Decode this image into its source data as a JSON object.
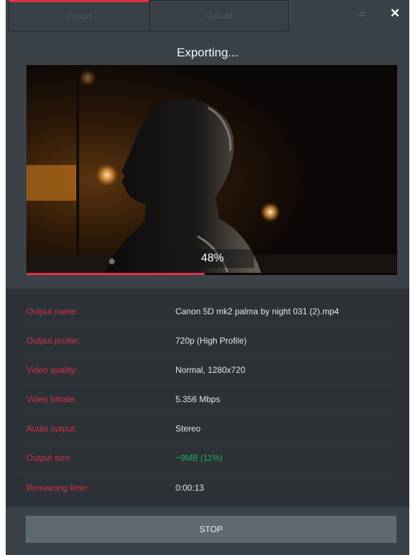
{
  "tabs": [
    {
      "label": "Export"
    },
    {
      "label": "Upload"
    }
  ],
  "window_controls": {
    "close_glyph": "✕",
    "minimize_icon": "minimize-tray-icon"
  },
  "title": "Exporting...",
  "preview": {
    "percent_label": "48%",
    "progress_fraction": 0.48
  },
  "details": [
    {
      "label": "Output name:",
      "value": "Canon 5D mk2 palma by night 031 (2).mp4"
    },
    {
      "label": "Output profile:",
      "value": "720p (High Profile)"
    },
    {
      "label": "Video quality:",
      "value": "Normal, 1280x720"
    },
    {
      "label": "Video bitrate:",
      "value": "5.356 Mbps"
    },
    {
      "label": "Audio output:",
      "value": "Stereo"
    },
    {
      "label": "Output size:",
      "value": "~9MB (11%)"
    },
    {
      "label": "Remaining time:",
      "value": "0:00:13"
    }
  ],
  "stop_label": "STOP",
  "colors": {
    "accent": "#e0304e",
    "label": "#d8304a",
    "success": "#1fae5e",
    "background": "#3a4247",
    "panel": "#2c3236",
    "button": "#5e6970"
  }
}
